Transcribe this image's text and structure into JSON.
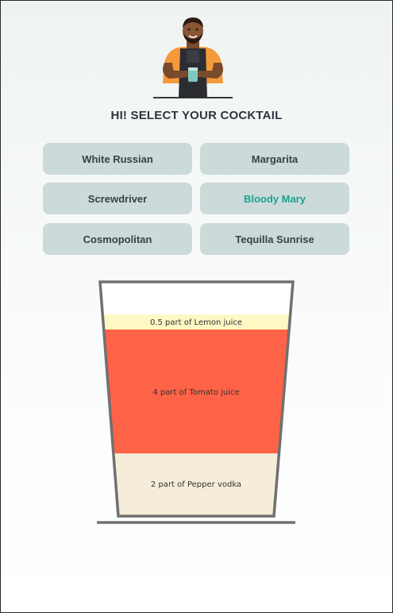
{
  "header": {
    "title": "HI! SELECT YOUR COCKTAIL"
  },
  "cocktails": [
    {
      "label": "White Russian"
    },
    {
      "label": "Margarita"
    },
    {
      "label": "Screwdriver"
    },
    {
      "label": "Bloody Mary",
      "selected": true
    },
    {
      "label": "Cosmopolitan"
    },
    {
      "label": "Tequilla Sunrise"
    }
  ],
  "colors": {
    "accent": "#1ba392",
    "button_bg": "#ccdad9"
  },
  "glass": {
    "layers": [
      {
        "label": "0.5 part of Lemon juice",
        "color": "#fdf8c4"
      },
      {
        "label": "4 part of Tomato juice",
        "color": "#ff6347"
      },
      {
        "label": "2 part of Pepper vodka",
        "color": "#f5ecda"
      }
    ]
  }
}
